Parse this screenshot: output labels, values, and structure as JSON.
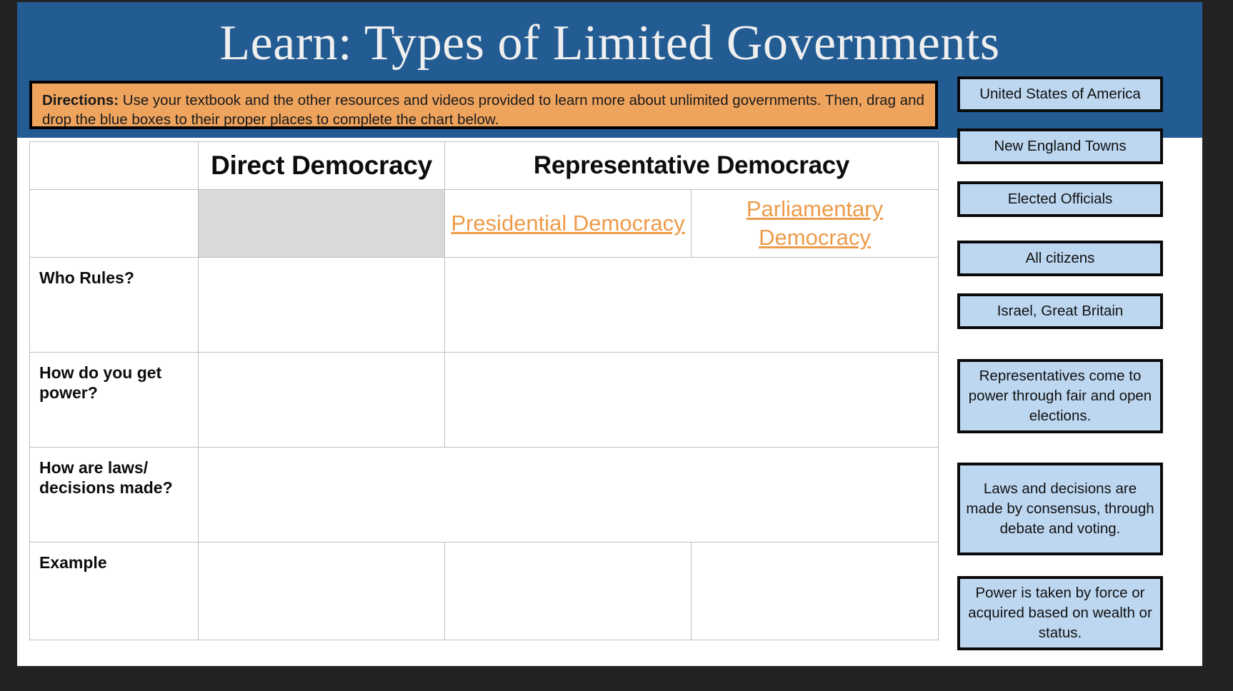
{
  "slide": {
    "title": "Learn: Types of Limited Governments",
    "title_band_color": "#235C93",
    "directions": {
      "label": "Directions:",
      "body": " Use your textbook and the other resources and videos provided to learn more about unlimited governments. Then, drag and drop the blue boxes to their proper places to complete the chart below.",
      "background_color": "#EFA45E"
    }
  },
  "chart": {
    "columns": {
      "blank": "",
      "direct_democracy": "Direct Democracy",
      "representative_democracy": "Representative Democracy",
      "presidential_democracy": "Presidential Democracy",
      "parliamentary_democracy": "Parliamentary Democracy"
    },
    "link_color": "#ED9B4A",
    "greyed_cell_color": "#D9D9D9",
    "rows": [
      {
        "label": "Who Rules?",
        "direct": "",
        "representative": ""
      },
      {
        "label": "How do you get power?",
        "direct": "",
        "representative": ""
      },
      {
        "label": "How are laws/ decisions made?",
        "merged": ""
      },
      {
        "label": "Example",
        "direct": "",
        "presidential": "",
        "parliamentary": ""
      }
    ]
  },
  "drag_bank": {
    "box_fill_color": "#BDD7F1",
    "items": [
      {
        "label": "United States of America"
      },
      {
        "label": "New England Towns"
      },
      {
        "label": "Elected Officials"
      },
      {
        "label": "All citizens"
      },
      {
        "label": "Israel, Great Britain"
      },
      {
        "label": "Representatives come to power through fair and open elections."
      },
      {
        "label": "Laws and decisions are made by consensus, through debate and voting."
      },
      {
        "label": "Power is taken by force or acquired based on wealth or status."
      }
    ]
  }
}
